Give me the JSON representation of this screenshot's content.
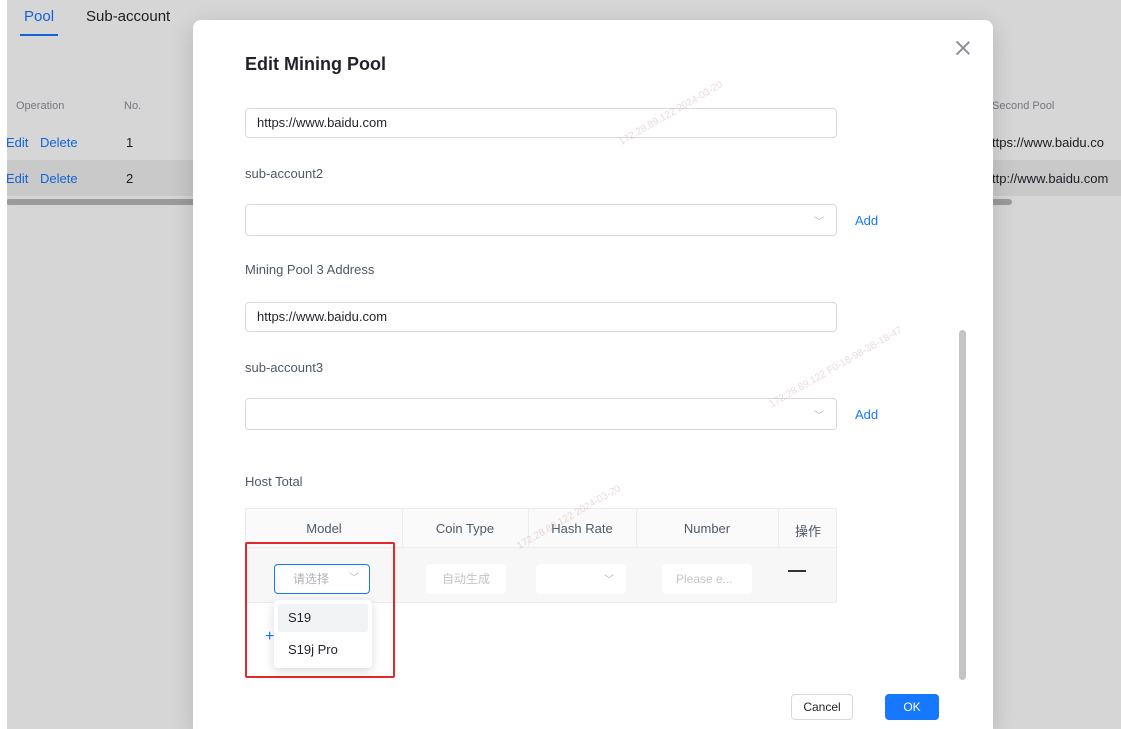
{
  "background": {
    "tabs": [
      "Pool",
      "Sub-account"
    ],
    "table_headers": {
      "operation": "Operation",
      "no": "No.",
      "second_pool": "Second Pool"
    },
    "rows": [
      {
        "edit": "Edit",
        "delete": "Delete",
        "no": "1",
        "second_pool": "ttps://www.baidu.co"
      },
      {
        "edit": "Edit",
        "delete": "Delete",
        "no": "2",
        "second_pool": "ttp://www.baidu.com"
      }
    ]
  },
  "modal": {
    "title": "Edit Mining Pool",
    "pool2_address_value": "https://www.baidu.com",
    "sub_account2_label": "sub-account2",
    "pool3_address_label": "Mining Pool 3 Address",
    "pool3_address_value": "https://www.baidu.com",
    "sub_account3_label": "sub-account3",
    "add_label": "Add",
    "host_total_label": "Host Total",
    "host_table": {
      "headers": [
        "Model",
        "Coin Type",
        "Hash Rate",
        "Number",
        "操作"
      ],
      "model_placeholder": "请选择",
      "coin_type_value": "自动生成",
      "number_placeholder": "Please e..."
    },
    "model_options": [
      "S19",
      "S19j Pro"
    ],
    "cancel_label": "Cancel",
    "ok_label": "OK"
  },
  "watermark": [
    "172.28.89.122",
    "2024-03-20",
    "F0-18-98-3B-18-47"
  ],
  "colors": {
    "accent": "#1677ff",
    "highlight_border": "#e0282d"
  },
  "icons": {
    "close": "close-icon",
    "chevron": "chevron-down-icon",
    "plus": "plus-icon",
    "remove": "minus-icon"
  }
}
